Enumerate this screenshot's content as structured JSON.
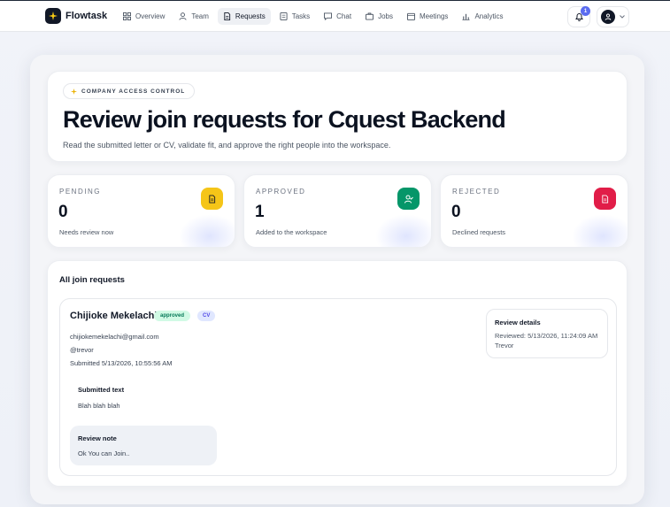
{
  "app": {
    "name": "Flowtask"
  },
  "nav": {
    "items": [
      {
        "label": "Overview",
        "icon": "grid-icon"
      },
      {
        "label": "Team",
        "icon": "user-icon"
      },
      {
        "label": "Requests",
        "icon": "document-icon",
        "active": true
      },
      {
        "label": "Tasks",
        "icon": "list-icon"
      },
      {
        "label": "Chat",
        "icon": "chat-icon"
      },
      {
        "label": "Jobs",
        "icon": "briefcase-icon"
      },
      {
        "label": "Meetings",
        "icon": "calendar-icon"
      },
      {
        "label": "Analytics",
        "icon": "bar-chart-icon"
      }
    ],
    "notifications_count": "1"
  },
  "hero": {
    "chip": "COMPANY ACCESS CONTROL",
    "title": "Review join requests for Cquest Backend",
    "subtitle": "Read the submitted letter or CV, validate fit, and approve the right people into the workspace."
  },
  "stats": [
    {
      "label": "PENDING",
      "value": "0",
      "desc": "Needs review now",
      "color": "#f5c518",
      "icon": "document-icon"
    },
    {
      "label": "APPROVED",
      "value": "1",
      "desc": "Added to the workspace",
      "color": "#059669",
      "icon": "user-check-icon"
    },
    {
      "label": "REJECTED",
      "value": "0",
      "desc": "Declined requests",
      "color": "#e11d48",
      "icon": "document-icon"
    }
  ],
  "requests": {
    "title": "All join requests",
    "items": [
      {
        "name": "Chijioke Mekelachi",
        "status": "approved",
        "type": "CV",
        "email": "chijiokemekelachi@gmail.com",
        "handle": "@trevor",
        "submitted": "Submitted 5/13/2026, 10:55:56 AM",
        "submitted_text_title": "Submitted text",
        "submitted_text": "Blah blah blah",
        "review_note_title": "Review note",
        "review_note": "Ok You can Join..",
        "details_title": "Review details",
        "reviewed": "Reviewed: 5/13/2026, 11:24:09 AM",
        "reviewer": "Trevor"
      }
    ]
  }
}
